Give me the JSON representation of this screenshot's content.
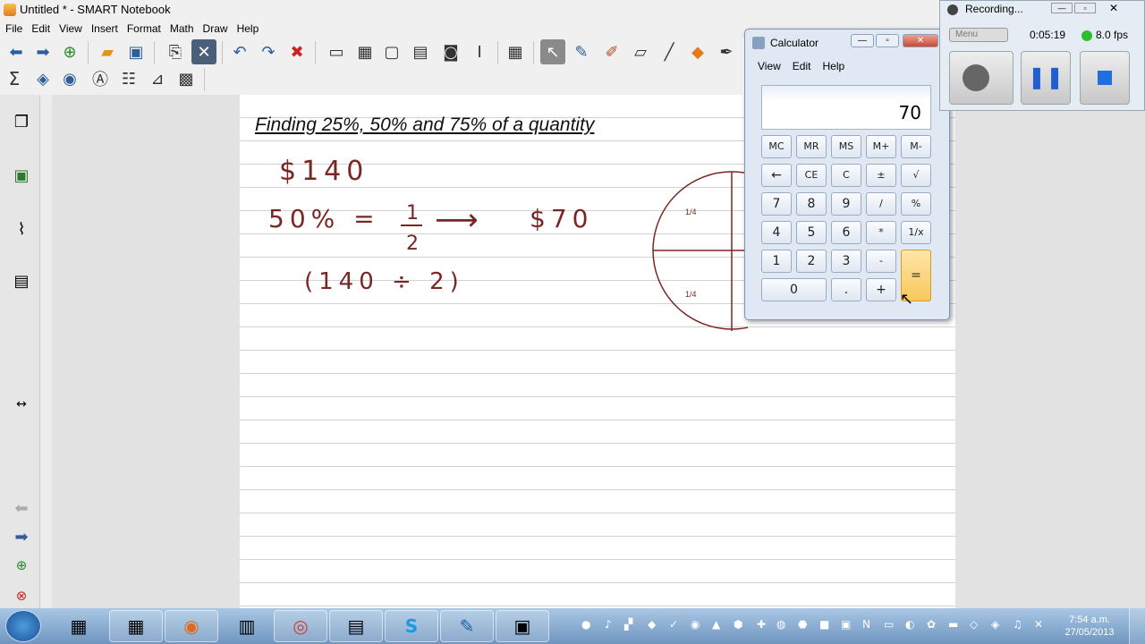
{
  "window": {
    "title": "Untitled * - SMART Notebook"
  },
  "menu": [
    "File",
    "Edit",
    "View",
    "Insert",
    "Format",
    "Math",
    "Draw",
    "Help"
  ],
  "toolbar": {
    "row1_icons": [
      "back-arrow-icon",
      "forward-arrow-icon",
      "add-page-icon",
      "delete-page-icon",
      "open-folder-icon",
      "save-icon",
      "paste-icon",
      "close-x-icon",
      "undo-icon",
      "redo-icon",
      "delete-icon",
      "screen-shade-icon",
      "full-screen-icon",
      "transparent-bg-icon",
      "capture-icon",
      "document-camera-icon",
      "table-icon",
      "select-arrow-icon",
      "pen-icon",
      "creative-pen-icon",
      "eraser-icon",
      "line-icon",
      "shapes-icon",
      "magic-pen-icon"
    ],
    "row2_icons": [
      "sigma-icon",
      "fill-icon",
      "properties-icon",
      "recognize-icon",
      "table-tool-icon",
      "chart-icon",
      "addon-icon"
    ]
  },
  "sidebar": {
    "icons": [
      "page-sorter-icon",
      "gallery-icon",
      "attachments-icon",
      "properties-icon"
    ]
  },
  "document": {
    "title": "Finding 25%, 50% and 75% of a quantity",
    "line1": "$140",
    "line2_left": "50%  =",
    "fraction_num": "1",
    "fraction_den": "2",
    "arrow": "⟶",
    "line2_right": "$70",
    "line3": "(140 ÷ 2)",
    "pie_quarter_labels": [
      "1/4",
      "1/4"
    ]
  },
  "calculator": {
    "title": "Calculator",
    "menu": [
      "View",
      "Edit",
      "Help"
    ],
    "display": "70",
    "keys": {
      "row1": [
        "MC",
        "MR",
        "MS",
        "M+",
        "M-"
      ],
      "row2": [
        "←",
        "CE",
        "C",
        "±",
        "√"
      ],
      "row3": [
        "7",
        "8",
        "9",
        "/",
        "%"
      ],
      "row4": [
        "4",
        "5",
        "6",
        "*",
        "1/x"
      ],
      "row5": [
        "1",
        "2",
        "3",
        "-",
        "="
      ],
      "row6": [
        "0",
        ".",
        "+"
      ]
    }
  },
  "recorder": {
    "title": "Recording...",
    "menu_label": "Menu",
    "time": "0:05:19",
    "fps": "8.0 fps"
  },
  "taskbar": {
    "clock_time": "7:54 a.m.",
    "clock_date": "27/05/2013"
  }
}
